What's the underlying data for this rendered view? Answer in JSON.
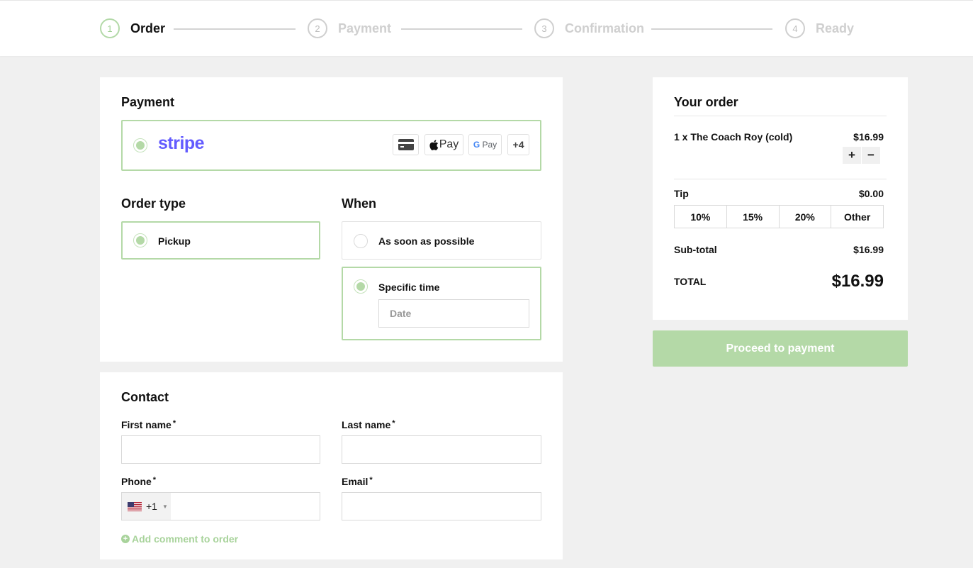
{
  "stepper": {
    "steps": [
      {
        "num": "1",
        "label": "Order"
      },
      {
        "num": "2",
        "label": "Payment"
      },
      {
        "num": "3",
        "label": "Confirmation"
      },
      {
        "num": "4",
        "label": "Ready"
      }
    ]
  },
  "payment": {
    "title": "Payment",
    "provider": "stripe",
    "methods": [
      "card-icon",
      "apple-pay",
      "google-pay"
    ],
    "apple_pay_label": "Pay",
    "google_pay_label": "Pay",
    "more_label": "+4"
  },
  "order_type": {
    "title": "Order type",
    "option": "Pickup"
  },
  "when": {
    "title": "When",
    "asap": "As soon as possible",
    "specific": "Specific time",
    "date_placeholder": "Date"
  },
  "contact": {
    "title": "Contact",
    "first_name": "First name",
    "last_name": "Last name",
    "phone": "Phone",
    "email": "Email",
    "required_mark": "*",
    "phone_code": "+1",
    "add_comment": "Add comment to order"
  },
  "summary": {
    "title": "Your order",
    "item": "1 x The Coach Roy (cold)",
    "item_price": "$16.99",
    "plus": "+",
    "minus": "−",
    "tip_label": "Tip",
    "tip_value": "$0.00",
    "tip_options": [
      "10%",
      "15%",
      "20%",
      "Other"
    ],
    "subtotal_label": "Sub-total",
    "subtotal_value": "$16.99",
    "total_label": "TOTAL",
    "total_value": "$16.99"
  },
  "proceed_label": "Proceed to payment",
  "colors": {
    "accent": "#b4d9a7",
    "stripe": "#635bff"
  }
}
